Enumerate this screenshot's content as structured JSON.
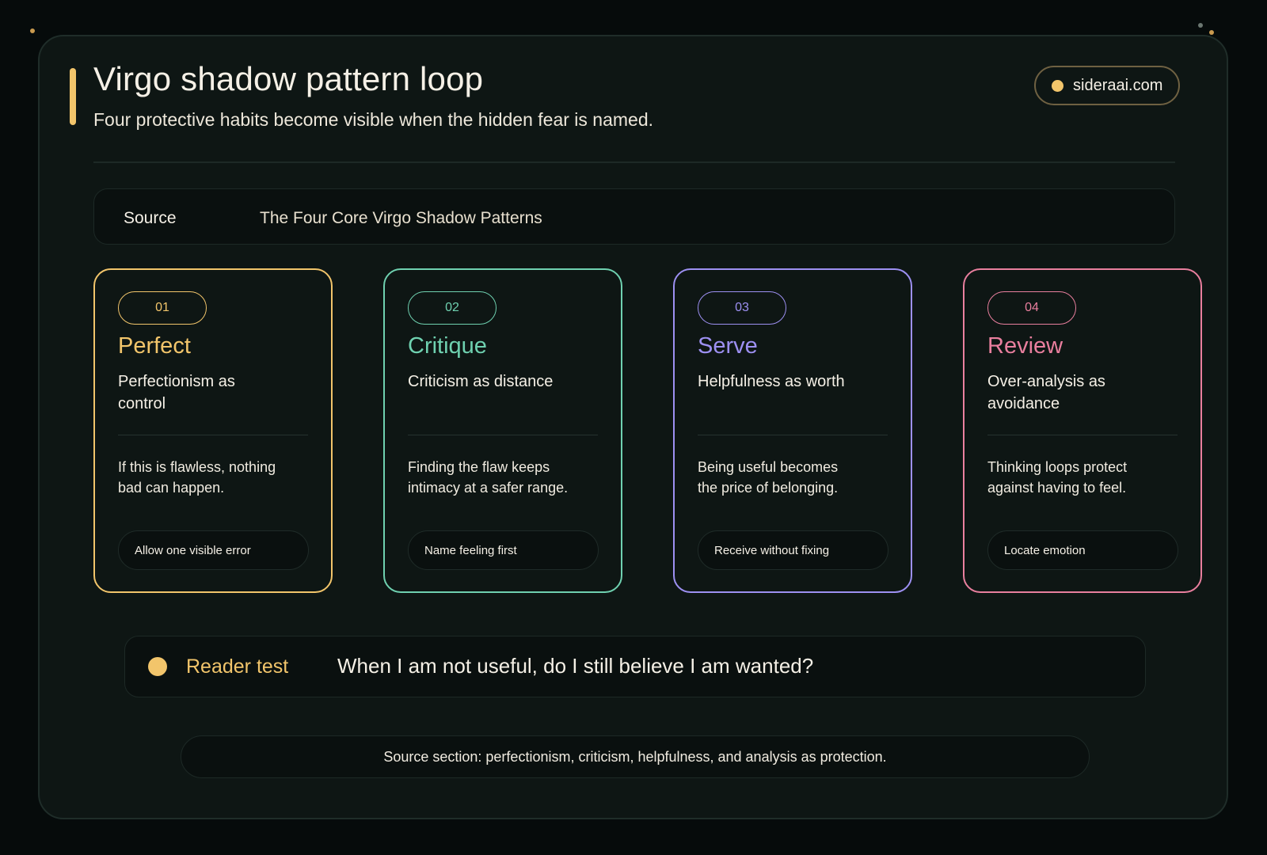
{
  "header": {
    "title": "Virgo shadow pattern loop",
    "subtitle": "Four protective habits become visible when the hidden fear is named.",
    "site": "sideraai.com"
  },
  "source": {
    "label": "Source",
    "value": "The Four Core Virgo Shadow Patterns"
  },
  "patterns": [
    {
      "number": "01",
      "name": "Perfect",
      "subtitle": "Perfectionism as control",
      "description": "If this is flawless, nothing bad can happen.",
      "action": "Allow one visible error",
      "color": "#f2c56b"
    },
    {
      "number": "02",
      "name": "Critique",
      "subtitle": "Criticism as distance",
      "description": "Finding the flaw keeps intimacy at a safer range.",
      "action": "Name feeling first",
      "color": "#6fd1b0"
    },
    {
      "number": "03",
      "name": "Serve",
      "subtitle": "Helpfulness as worth",
      "description": "Being useful becomes the price of belonging.",
      "action": "Receive without fixing",
      "color": "#9d90f2"
    },
    {
      "number": "04",
      "name": "Review",
      "subtitle": "Over-analysis as avoidance",
      "description": "Thinking loops protect against having to feel.",
      "action": "Locate emotion",
      "color": "#e97f9e"
    }
  ],
  "reader_test": {
    "label": "Reader test",
    "question": "When I am not useful, do I still believe I am wanted?"
  },
  "footnote": "Source section: perfectionism, criticism, helpfulness, and analysis as protection."
}
